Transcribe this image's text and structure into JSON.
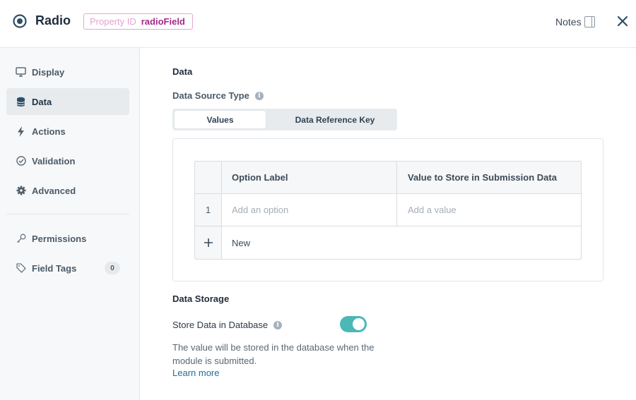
{
  "header": {
    "title": "Radio",
    "property_id_label": "Property ID",
    "property_id_value": "radioField",
    "notes_label": "Notes"
  },
  "sidebar": {
    "items": [
      {
        "label": "Display",
        "icon": "monitor-icon",
        "active": false
      },
      {
        "label": "Data",
        "icon": "database-icon",
        "active": true
      },
      {
        "label": "Actions",
        "icon": "lightning-icon",
        "active": false
      },
      {
        "label": "Validation",
        "icon": "check-circle-icon",
        "active": false
      },
      {
        "label": "Advanced",
        "icon": "gear-icon",
        "active": false
      },
      {
        "label": "Permissions",
        "icon": "key-icon",
        "active": false
      },
      {
        "label": "Field Tags",
        "icon": "tag-icon",
        "active": false,
        "count": "0"
      }
    ]
  },
  "main": {
    "section_title": "Data",
    "data_source_type_label": "Data Source Type",
    "segments": [
      "Values",
      "Data Reference Key"
    ],
    "selected_segment": "Values",
    "table": {
      "headers": [
        "Option Label",
        "Value to Store in Submission Data"
      ],
      "row_number": "1",
      "option_placeholder": "Add an option",
      "value_placeholder": "Add a value",
      "new_label": "New"
    },
    "storage_title": "Data Storage",
    "store_label": "Store Data in Database",
    "store_enabled": true,
    "help_text": "The value will be stored in the database when the module is submitted.",
    "learn_more": "Learn more"
  },
  "colors": {
    "accent_teal": "#4cb8b6",
    "property_badge": "#a3288a",
    "link": "#1e6f9a"
  }
}
